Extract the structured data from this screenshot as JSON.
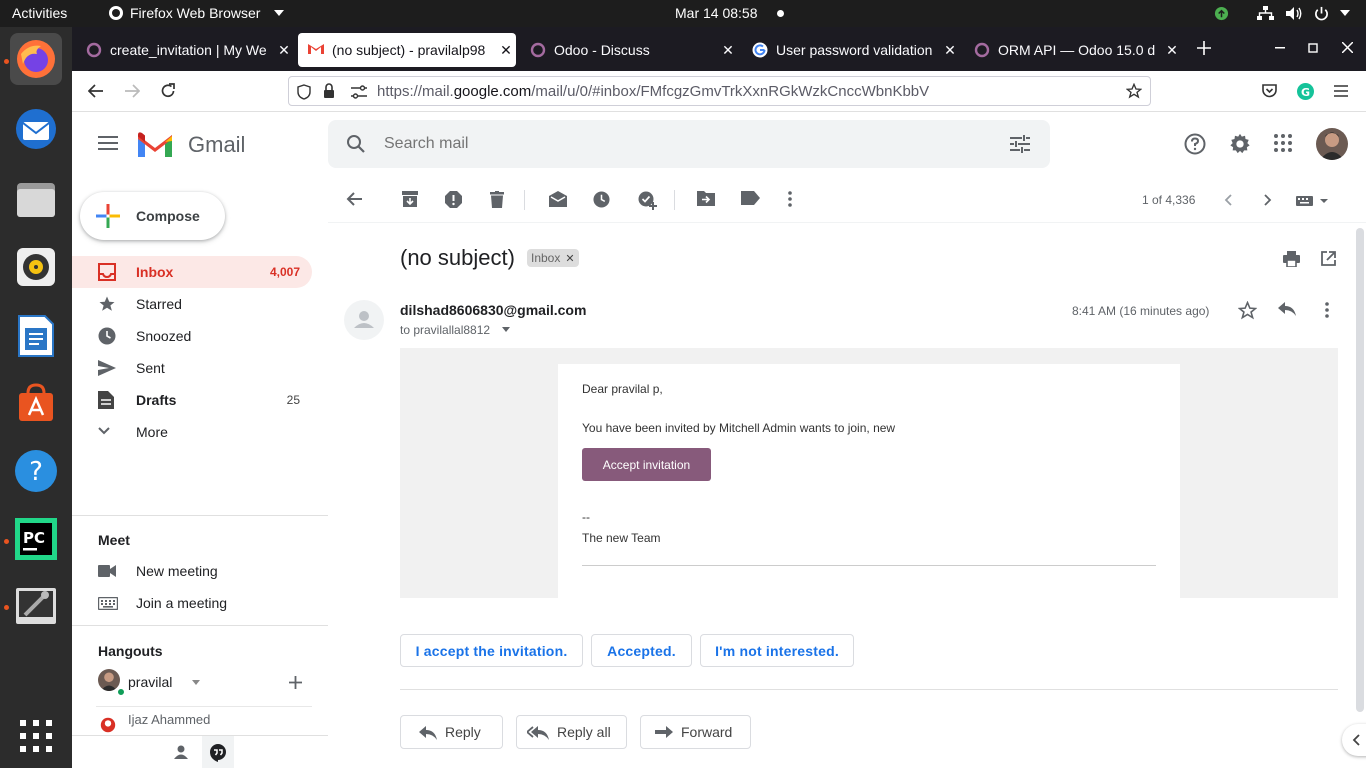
{
  "system": {
    "activities": "Activities",
    "app_name": "Firefox Web Browser",
    "clock": "Mar 14  08:58"
  },
  "browser": {
    "tabs": [
      {
        "title": "create_invitation | My We",
        "active": false
      },
      {
        "title": "(no subject) - pravilalp98",
        "active": true
      },
      {
        "title": "Odoo - Discuss",
        "active": false
      },
      {
        "title": "User password validation",
        "active": false
      },
      {
        "title": "ORM API — Odoo 15.0 d",
        "active": false
      }
    ],
    "url_prefix": "https://mail.",
    "url_domain": "google.com",
    "url_path": "/mail/u/0/#inbox/FMfcgzGmvTrkXxnRGkWzkCnccWbnKbbV"
  },
  "gmail": {
    "logo_text": "Gmail",
    "search_placeholder": "Search mail",
    "compose_label": "Compose",
    "nav": [
      {
        "label": "Inbox",
        "count": "4,007"
      },
      {
        "label": "Starred",
        "count": ""
      },
      {
        "label": "Snoozed",
        "count": ""
      },
      {
        "label": "Sent",
        "count": ""
      },
      {
        "label": "Drafts",
        "count": "25"
      },
      {
        "label": "More",
        "count": ""
      }
    ],
    "meet": {
      "heading": "Meet",
      "new_meeting": "New meeting",
      "join_meeting": "Join a meeting"
    },
    "hangouts": {
      "heading": "Hangouts",
      "user": "pravilal",
      "contact": "Ijaz Ahammed"
    },
    "pagination": "1 of 4,336",
    "email": {
      "subject": "(no subject)",
      "label_chip": "Inbox",
      "sender": "dilshad8606830@gmail.com",
      "to": "to pravilallal8812",
      "time": "8:41 AM (16 minutes ago)",
      "body": {
        "greeting": "Dear pravilal p,",
        "line1": "You have been invited by Mitchell Admin wants to join, new",
        "accept_button": "Accept invitation",
        "sig_dash": "--",
        "signature": "The new Team"
      }
    },
    "smart_replies": [
      "I accept the invitation.",
      "Accepted.",
      "I'm not interested."
    ],
    "actions": {
      "reply": "Reply",
      "reply_all": "Reply all",
      "forward": "Forward"
    }
  }
}
